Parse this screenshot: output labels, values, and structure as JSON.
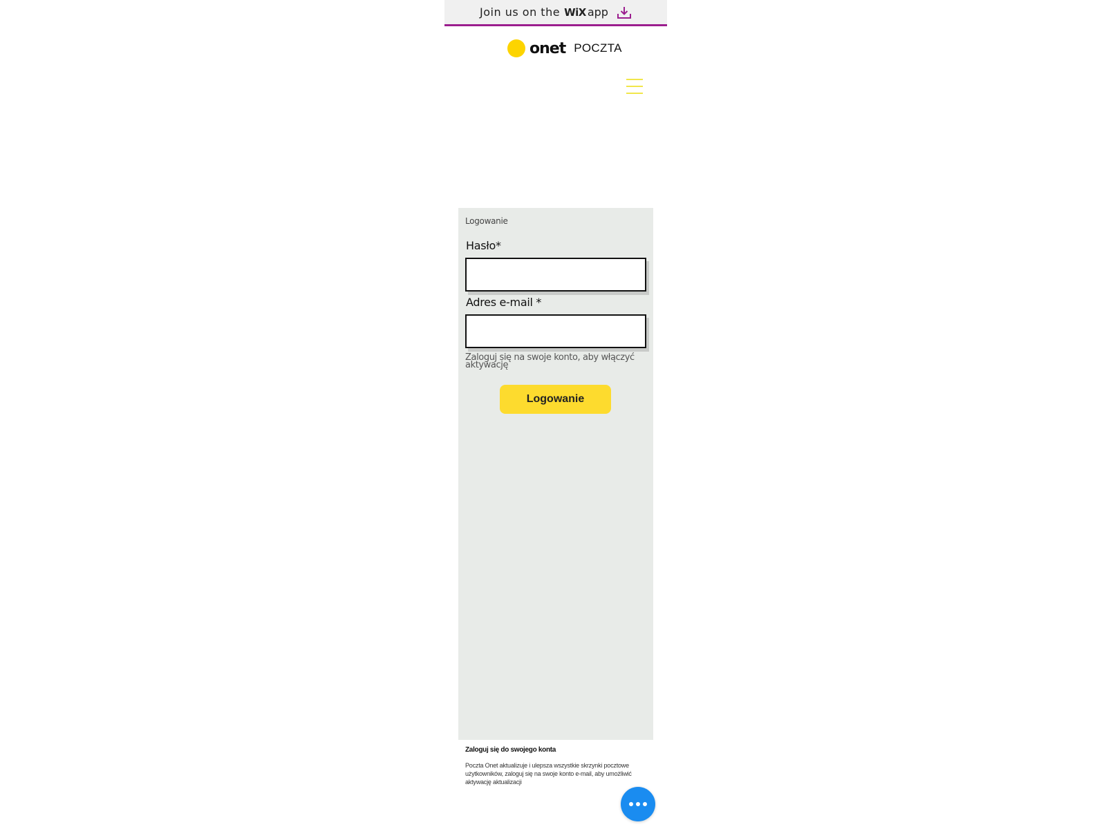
{
  "banner": {
    "text": "Join us on the",
    "brand": "WiX",
    "app": "app",
    "icon": "download-icon",
    "accent_color": "#9b1d8e"
  },
  "logo": {
    "wordmark": "onet",
    "product": "POCZTA",
    "dot_color": "#fdd400"
  },
  "menu": {
    "icon": "hamburger-menu-icon",
    "color": "#f1e64a"
  },
  "login_form": {
    "title": "Logowanie",
    "password_label": "Hasło*",
    "password_value": "",
    "email_label": "Adres e-mail *",
    "email_value": "",
    "hint": "Zaloguj się na swoje konto, aby włączyć aktywację",
    "submit_label": "Logowanie",
    "submit_color": "#fddb2e",
    "panel_color": "#e8ebe8"
  },
  "footer": {
    "title": "Zaloguj się do swojego konta",
    "body": "Poczta Onet aktualizuje i ulepsza wszystkie skrzynki pocztowe użytkowników, zaloguj się na swoje konto e-mail, aby umożliwić aktywację aktualizacji"
  },
  "fab": {
    "icon": "more-dots-icon",
    "color": "#1a8cf0"
  }
}
